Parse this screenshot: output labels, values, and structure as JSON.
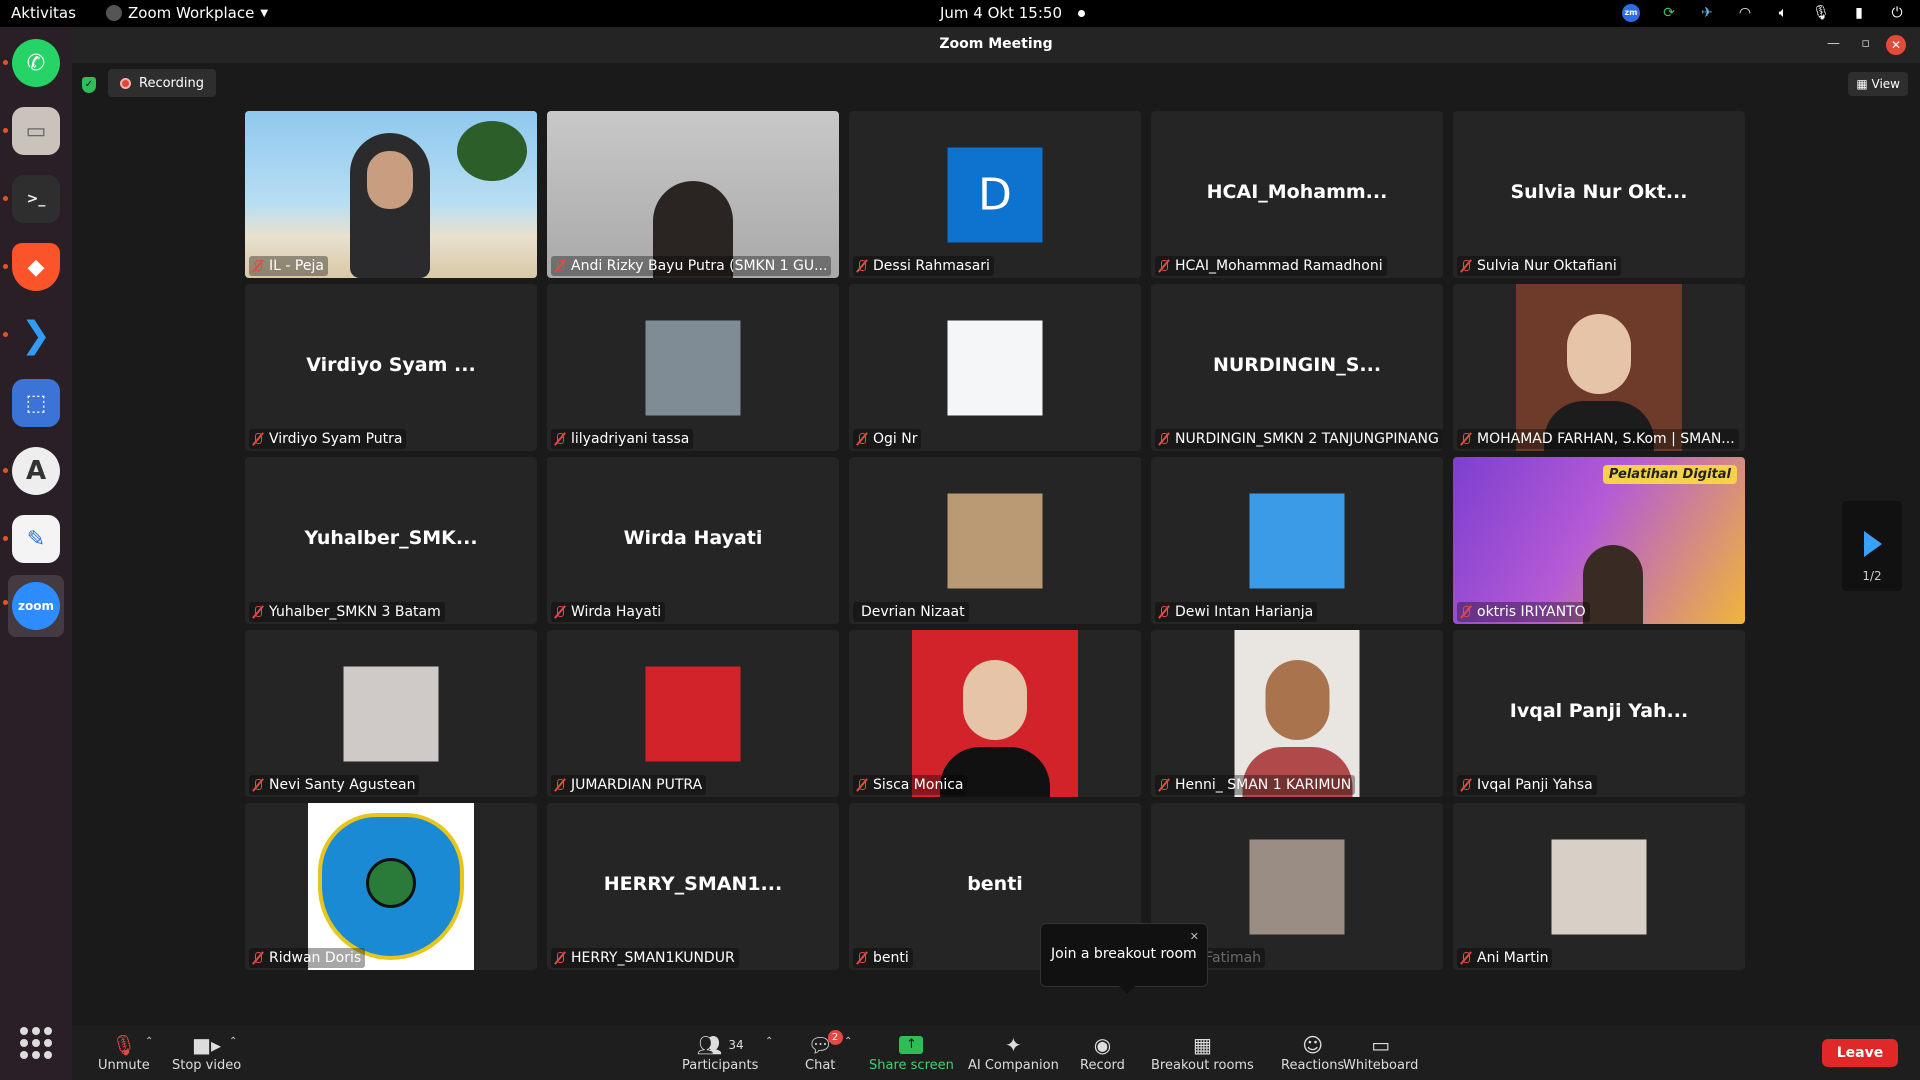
{
  "topbar": {
    "activities": "Aktivitas",
    "app": "Zoom Workplace",
    "clock": "Jum  4 Okt  15:50"
  },
  "window": {
    "title": "Zoom Meeting",
    "recording": "Recording",
    "view": "View"
  },
  "participants": [
    {
      "name": "IL - Peja",
      "big": ""
    },
    {
      "name": "Andi Rizky Bayu Putra (SMKN 1 GU...",
      "big": ""
    },
    {
      "name": "Dessi Rahmasari",
      "big": "",
      "letter": "D"
    },
    {
      "name": "HCAI_Mohammad Ramadhoni",
      "big": "HCAI_Mohamm..."
    },
    {
      "name": "Sulvia Nur Oktafiani",
      "big": "Sulvia Nur Okt..."
    },
    {
      "name": "Virdiyo Syam Putra",
      "big": "Virdiyo Syam ..."
    },
    {
      "name": "lilyadriyani tassa",
      "big": ""
    },
    {
      "name": "Ogi Nr",
      "big": ""
    },
    {
      "name": "NURDINGIN_SMKN 2 TANJUNGPINANG",
      "big": "NURDINGIN_S..."
    },
    {
      "name": "MOHAMAD FARHAN, S.Kom | SMAN...",
      "big": ""
    },
    {
      "name": "Yuhalber_SMKN 3 Batam",
      "big": "Yuhalber_SMK..."
    },
    {
      "name": "Wirda Hayati",
      "big": "Wirda Hayati"
    },
    {
      "name": "Devrian Nizaat",
      "big": ""
    },
    {
      "name": "Dewi Intan Harianja",
      "big": ""
    },
    {
      "name": "oktris IRIYANTO",
      "big": "",
      "banner": "Pelatihan Digital"
    },
    {
      "name": "Nevi Santy Agustean",
      "big": ""
    },
    {
      "name": "JUMARDIAN PUTRA",
      "big": ""
    },
    {
      "name": "Sisca Monica",
      "big": ""
    },
    {
      "name": "Henni_ SMAN 1 KARIMUN",
      "big": ""
    },
    {
      "name": "Ivqal Panji Yahsa",
      "big": "Ivqal Panji Yah..."
    },
    {
      "name": "Ridwan Doris",
      "big": ""
    },
    {
      "name": "HERRY_SMAN1KUNDUR",
      "big": "HERRY_SMAN1..."
    },
    {
      "name": "benti",
      "big": "benti"
    },
    {
      "name": "Ayu Fatimah",
      "big": ""
    },
    {
      "name": "Ani Martin",
      "big": ""
    }
  ],
  "pager": "1/2",
  "tooltip": "Join a breakout room",
  "toolbar": {
    "unmute": "Unmute",
    "stop_video": "Stop video",
    "participants": "Participants",
    "participants_count": "34",
    "chat": "Chat",
    "chat_badge": "2",
    "share": "Share screen",
    "ai": "AI Companion",
    "record": "Record",
    "breakout": "Breakout rooms",
    "reactions": "Reactions",
    "whiteboard": "Whiteboard",
    "leave": "Leave"
  },
  "colors": {
    "accent_green": "#3fd46e",
    "leave_red": "#e02828",
    "mute_red": "#e24a44"
  }
}
